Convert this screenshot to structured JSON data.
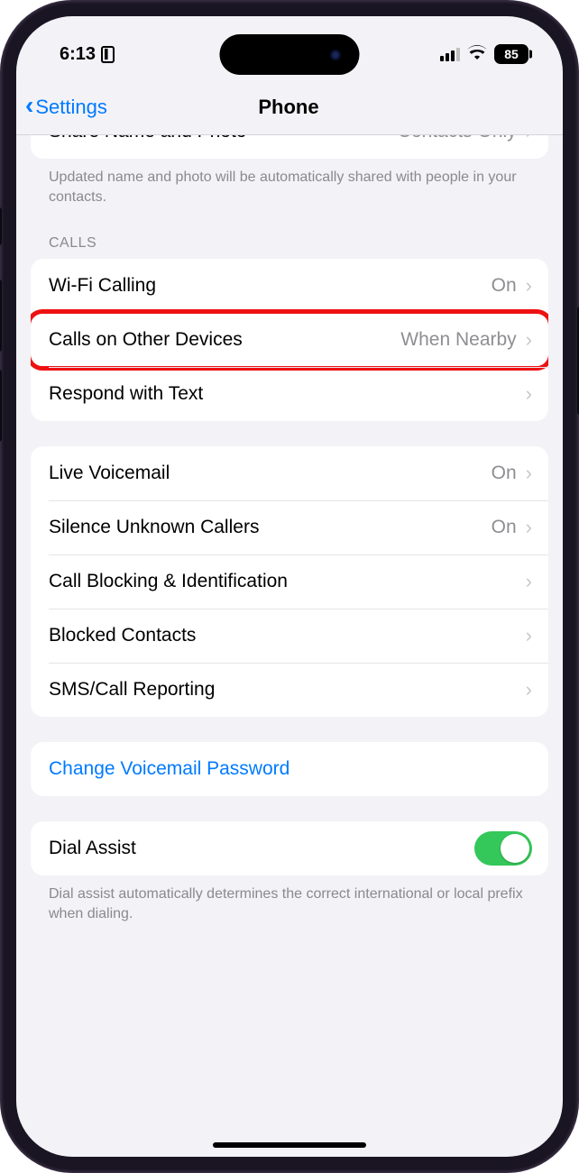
{
  "statusbar": {
    "time": "6:13",
    "battery": "85"
  },
  "nav": {
    "back": "Settings",
    "title": "Phone"
  },
  "partial": {
    "share_name": {
      "label": "Share Name and Photo",
      "value": "Contacts Only"
    },
    "caption": "Updated name and photo will be automatically shared with people in your contacts."
  },
  "sections": {
    "calls": {
      "header": "CALLS",
      "wifi_calling": {
        "label": "Wi-Fi Calling",
        "value": "On"
      },
      "other_devices": {
        "label": "Calls on Other Devices",
        "value": "When Nearby"
      },
      "respond_text": {
        "label": "Respond with Text"
      }
    },
    "misc": {
      "live_vm": {
        "label": "Live Voicemail",
        "value": "On"
      },
      "silence": {
        "label": "Silence Unknown Callers",
        "value": "On"
      },
      "blocking": {
        "label": "Call Blocking & Identification"
      },
      "blocked": {
        "label": "Blocked Contacts"
      },
      "sms_report": {
        "label": "SMS/Call Reporting"
      }
    },
    "voicemail_link": {
      "label": "Change Voicemail Password"
    },
    "dial": {
      "label": "Dial Assist",
      "caption": "Dial assist automatically determines the correct international or local prefix when dialing."
    }
  }
}
